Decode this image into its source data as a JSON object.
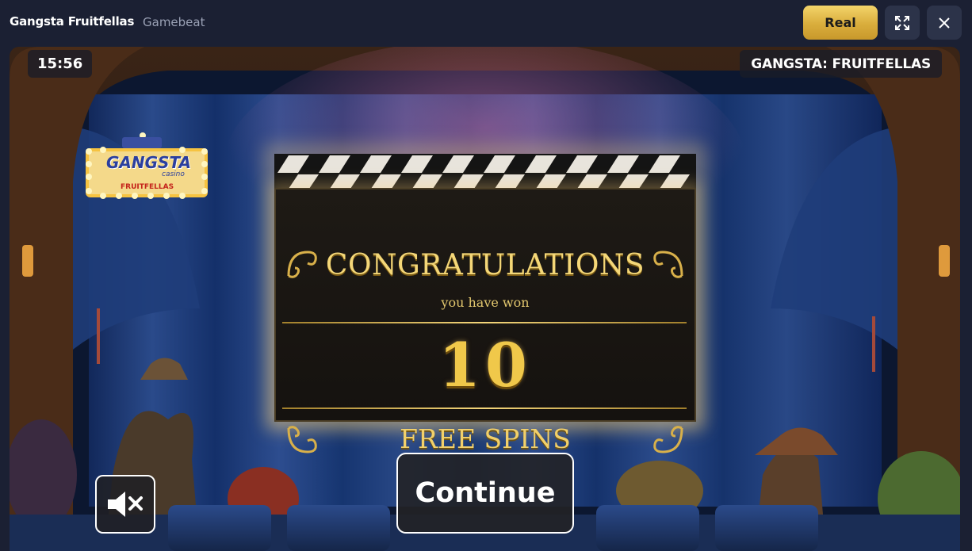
{
  "header": {
    "game_title": "Gangsta Fruitfellas",
    "provider": "Gamebeat",
    "real_label": "Real",
    "fullscreen_icon": "expand-icon",
    "close_icon": "close-icon"
  },
  "game": {
    "clock": "15:56",
    "name": "GANGSTA: FRUITFELLAS",
    "logo": {
      "brand": "GANGSTA",
      "sub": "casino",
      "tagline": "FRUITFELLAS"
    },
    "dialog": {
      "heading": "CONGRATULATIONS",
      "subheading": "you have won",
      "amount": "10",
      "prize": "FREE SPINS"
    },
    "continue_label": "Continue",
    "mute_icon": "sound-muted-icon"
  },
  "colors": {
    "gold_accent": "#e8c04f",
    "topbar_bg": "#1b2033",
    "curtain_blue": "#1d3766"
  }
}
